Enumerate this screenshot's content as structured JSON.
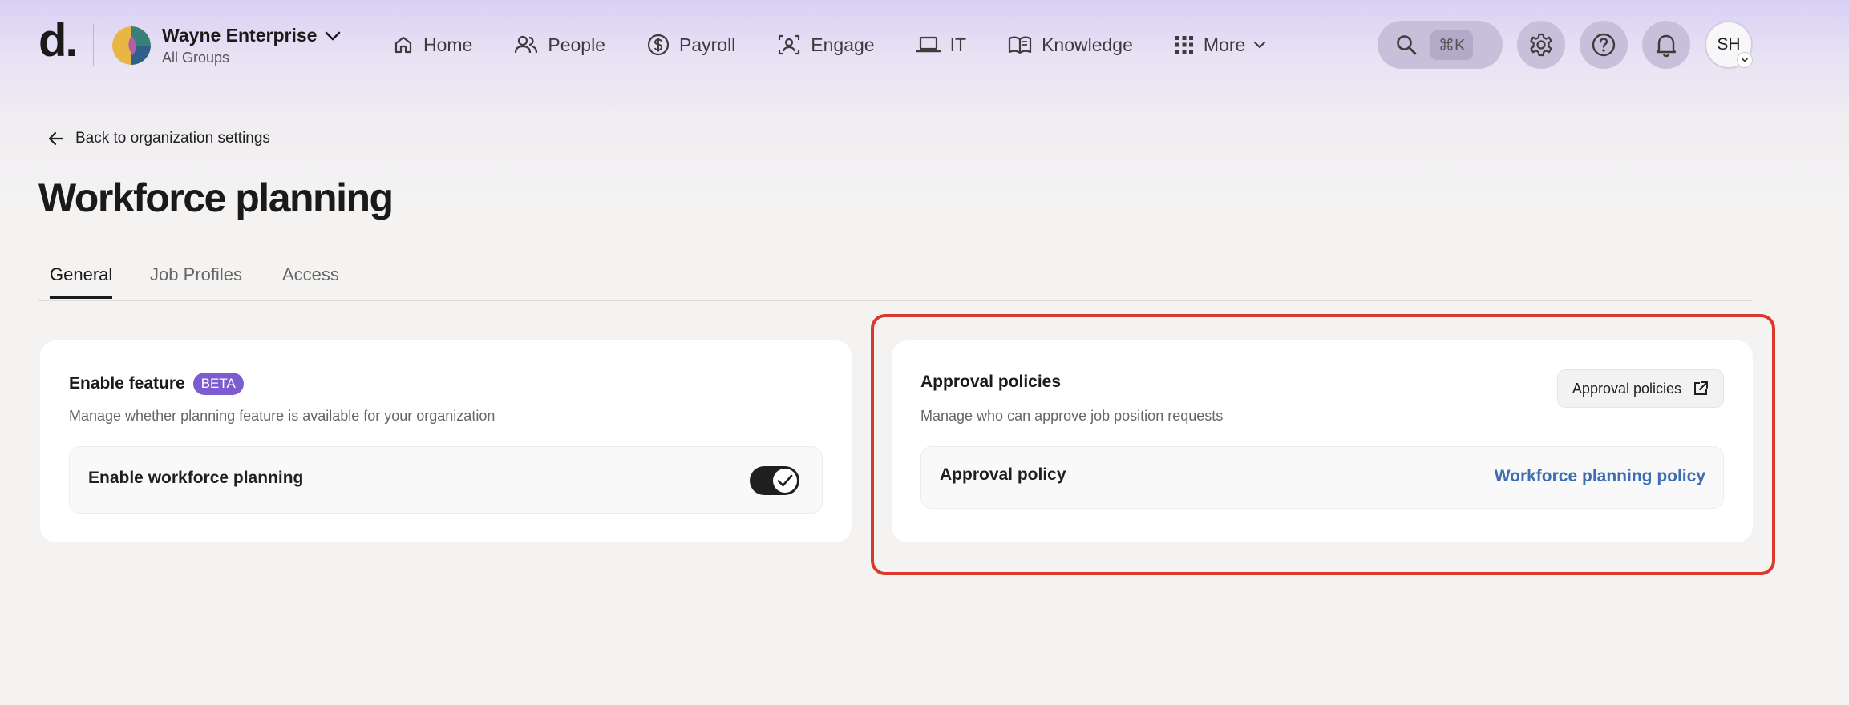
{
  "app": {
    "logo": "d.",
    "org_name": "Wayne Enterprise",
    "org_sub": "All Groups"
  },
  "nav": {
    "items": [
      {
        "label": "Home",
        "icon": "home-icon"
      },
      {
        "label": "People",
        "icon": "people-icon"
      },
      {
        "label": "Payroll",
        "icon": "dollar-icon"
      },
      {
        "label": "Engage",
        "icon": "engage-icon"
      },
      {
        "label": "IT",
        "icon": "laptop-icon"
      },
      {
        "label": "Knowledge",
        "icon": "book-icon"
      },
      {
        "label": "More",
        "icon": "grid-icon"
      }
    ]
  },
  "toolbar": {
    "search_shortcut": "⌘K",
    "avatar_initials": "SH"
  },
  "page": {
    "back_label": "Back to organization settings",
    "title": "Workforce planning"
  },
  "tabs": [
    {
      "label": "General",
      "active": true
    },
    {
      "label": "Job Profiles",
      "active": false
    },
    {
      "label": "Access",
      "active": false
    }
  ],
  "enable_card": {
    "title": "Enable feature",
    "badge": "BETA",
    "description": "Manage whether planning feature is available for your organization",
    "row_label": "Enable workforce planning",
    "toggle_on": true
  },
  "approval_card": {
    "title": "Approval policies",
    "description": "Manage who can approve job position requests",
    "button_label": "Approval policies",
    "row_label": "Approval policy",
    "policy_link": "Workforce planning policy"
  },
  "colors": {
    "accent": "#7c5ccf",
    "link": "#3d6fb0",
    "highlight": "#d93a2b"
  }
}
